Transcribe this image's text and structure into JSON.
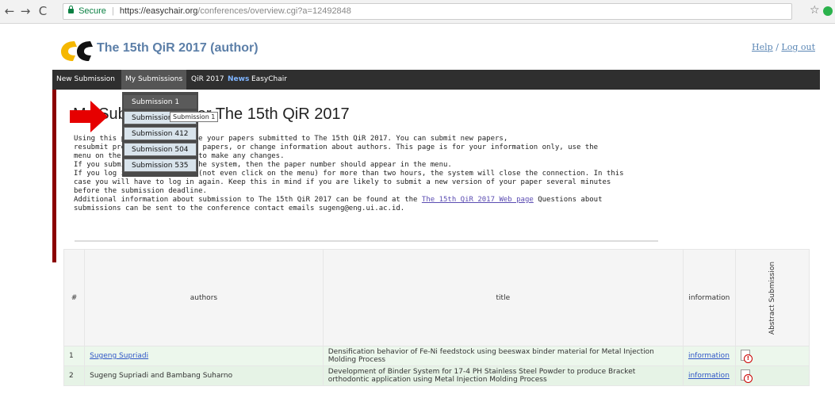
{
  "browser": {
    "back": "←",
    "forward": "→",
    "reload": "C",
    "secure_label": "Secure",
    "url_host": "https://easychair.org",
    "url_path": "/conferences/overview.cgi?a=12492848",
    "star": "☆"
  },
  "header": {
    "title": "The 15th QiR 2017 (author)",
    "help": "Help",
    "separator": "/",
    "logout": "Log out"
  },
  "menu": {
    "new_submission": "New Submission",
    "my_submissions": "My Submissions",
    "qir": "QiR 2017",
    "news": "News",
    "easychair": "EasyChair"
  },
  "dropdown": {
    "items": [
      "Submission 1",
      "Submission 2",
      "Submission 412",
      "Submission 504",
      "Submission 535"
    ],
    "tooltip": "Submission 1"
  },
  "content": {
    "title": "My Submissions for The 15th QiR 2017",
    "lines": [
      "Using this page you can manage your papers submitted to The 15th QiR 2017. You can submit new papers,",
      "resubmit previously submitted papers, or change information about authors. This page is for your information only, use the",
      "menu on the top of this page to make any changes.",
      "If you submit a paper using the system, then the paper number should appear in the menu.",
      "If you log in and do nothing (not even click on the menu) for more than two hours, the system will close the connection. In this",
      "case you will have to log in again. Keep this in mind if you are likely to submit a new version of your paper several minutes",
      "before the submission deadline."
    ],
    "info_prefix": "Additional information about submission to The 15th QiR 2017 can be found at the ",
    "info_link": "The 15th QiR 2017 Web page",
    "info_suffix": " Questions about",
    "info_last": "submissions can be sent to the conference contact emails sugeng@eng.ui.ac.id."
  },
  "table": {
    "headers": {
      "num": "#",
      "authors": "authors",
      "title": "title",
      "information": "information",
      "abstract": "Abstract Submission"
    },
    "rows": [
      {
        "num": "1",
        "authors": "Sugeng Supriadi",
        "title": "Densification behavior of Fe-Ni feedstock using beeswax binder material for Metal Injection Molding Process",
        "information": "information"
      },
      {
        "num": "2",
        "authors": "Sugeng Supriadi and Bambang Suharno",
        "title": "Development of Binder System for 17-4 PH Stainless Steel Powder to produce Bracket orthodontic application using Metal Injection Molding Process",
        "information": "information"
      }
    ]
  },
  "colors": {
    "menubar": "#2f2f2f",
    "accent_red": "#8b0000",
    "title_blue": "#5c7fa8",
    "arrow": "#e60000"
  }
}
